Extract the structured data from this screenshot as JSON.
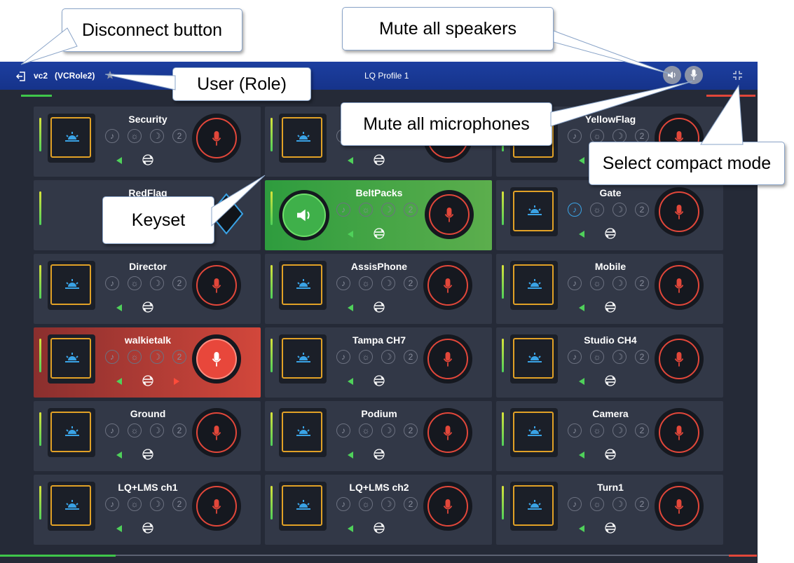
{
  "header": {
    "user": "vc2",
    "role": "(VCRole2)",
    "profile": "LQ Profile 1",
    "buttons": {
      "disconnect_icon": "logout-icon",
      "mute_speakers_icon": "speaker-icon",
      "mute_mics_icon": "mic-icon",
      "compact_icon": "compress-icon"
    }
  },
  "keysets": [
    {
      "name": "Security"
    },
    {
      "name": ""
    },
    {
      "name": "YellowFlag"
    },
    {
      "name": "RedFlag"
    },
    {
      "name": "BeltPacks"
    },
    {
      "name": "Gate"
    },
    {
      "name": "Director"
    },
    {
      "name": "AssisPhone"
    },
    {
      "name": "Mobile"
    },
    {
      "name": "walkietalk"
    },
    {
      "name": "Tampa CH7"
    },
    {
      "name": "Studio CH4"
    },
    {
      "name": "Ground"
    },
    {
      "name": "Podium"
    },
    {
      "name": "Camera"
    },
    {
      "name": "LQ+LMS ch1"
    },
    {
      "name": "LQ+LMS ch2"
    },
    {
      "name": "Turn1"
    }
  ],
  "callouts": {
    "disconnect": "Disconnect button",
    "mute_speakers": "Mute all speakers",
    "user_role": "User (Role)",
    "mute_mics": "Mute all microphones",
    "compact": "Select compact mode",
    "keyset": "Keyset"
  },
  "colors": {
    "topbar": "#1c3fa0",
    "background": "#252a37",
    "tile": "#323847",
    "talk_red": "#e2473a",
    "listen_green": "#3fb04a",
    "panel_orange": "#e1a126",
    "sun_blue": "#3aa3e6"
  }
}
